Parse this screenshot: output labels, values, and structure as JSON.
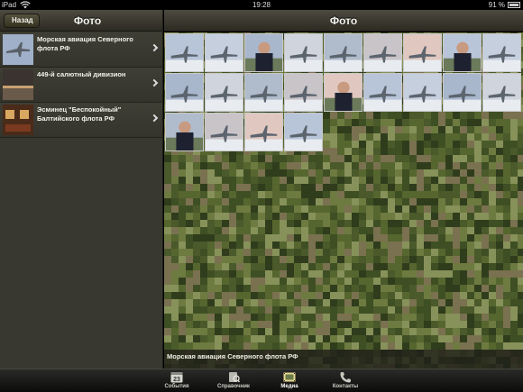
{
  "status_bar": {
    "device": "iPad",
    "time": "19:28",
    "battery": "91 %"
  },
  "left_pane": {
    "back_label": "Назад",
    "title": "Фото",
    "albums": [
      {
        "title": "Морская авиация Северного флота РФ"
      },
      {
        "title": "449-й салютный дивизион"
      },
      {
        "title": "Эсминец \"Беспокойный\" Балтийского флота РФ"
      }
    ]
  },
  "right_pane": {
    "title": "Фото",
    "caption": "Морская авиация Северного флота РФ",
    "photo_count": 22
  },
  "tab_bar": {
    "tabs": [
      {
        "label": "События",
        "icon": "calendar-icon",
        "calendar_day": "23"
      },
      {
        "label": "Справочник",
        "icon": "reference-book-icon"
      },
      {
        "label": "Медиа",
        "icon": "film-strip-icon",
        "active": true
      },
      {
        "label": "Контакты",
        "icon": "phone-icon"
      }
    ]
  },
  "colors": {
    "bar_dark": "#2c2a22",
    "camo_green": "#4f5d2e",
    "pane_bg": "#383830"
  }
}
